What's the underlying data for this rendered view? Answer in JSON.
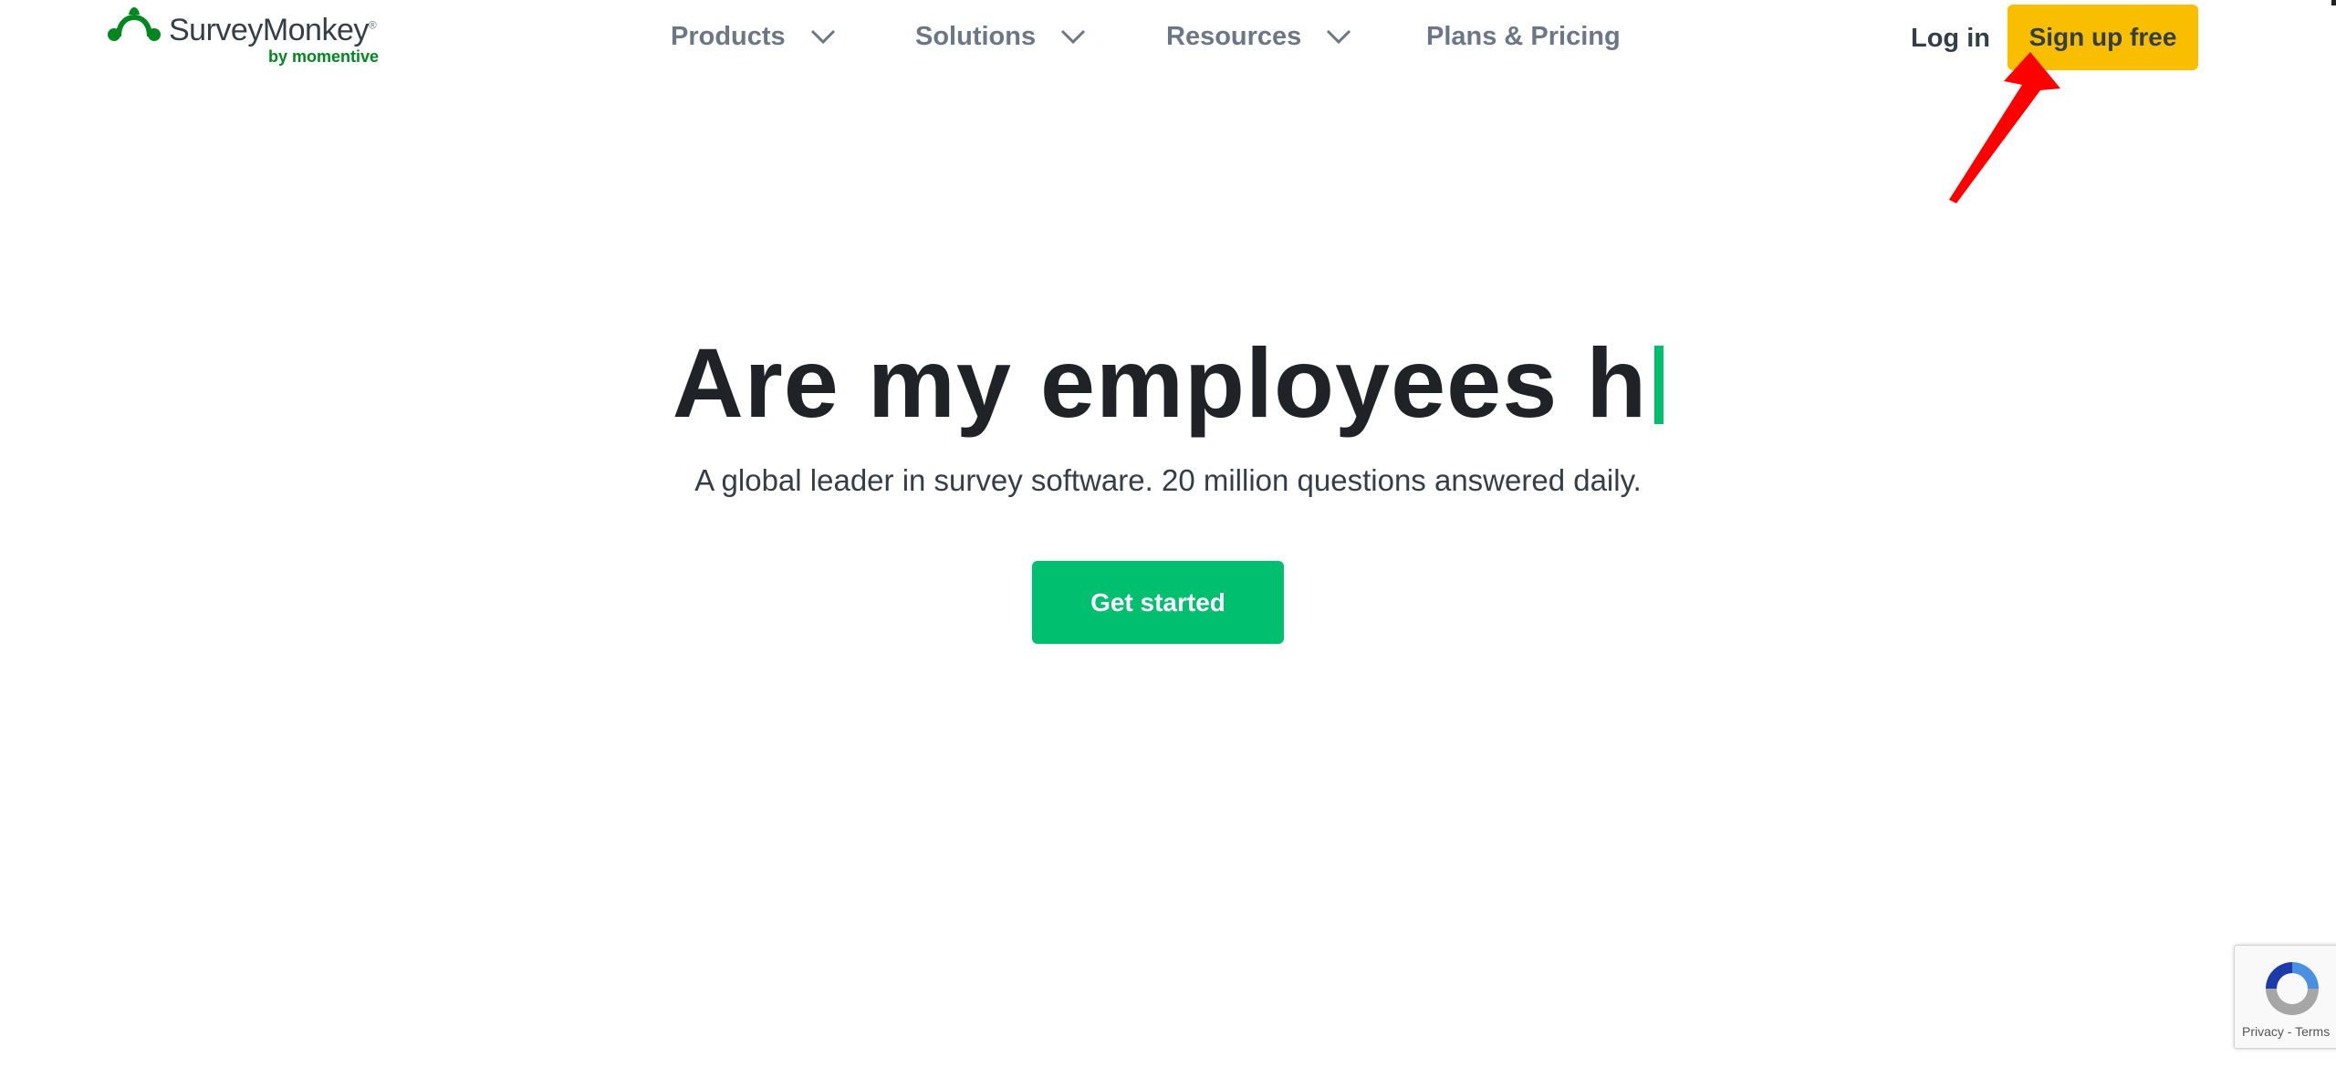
{
  "header": {
    "logo": {
      "wordmark": "SurveyMonkey",
      "registered": "®",
      "byline": "by momentive",
      "brand_green": "#00871f"
    },
    "nav": [
      {
        "label": "Products",
        "has_dropdown": true
      },
      {
        "label": "Solutions",
        "has_dropdown": true
      },
      {
        "label": "Resources",
        "has_dropdown": true
      },
      {
        "label": "Plans & Pricing",
        "has_dropdown": false
      }
    ],
    "login_label": "Log in",
    "signup_label": "Sign up free",
    "signup_color": "#f9be00"
  },
  "annotation": {
    "icon": "red-arrow",
    "color": "#ff0000"
  },
  "hero": {
    "title": "Are my employees h",
    "caret_color": "#00bf6f",
    "subtitle": "A global leader in survey software. 20 million questions answered daily.",
    "cta_label": "Get started",
    "cta_color": "#00bf6f"
  },
  "recaptcha": {
    "icon": "recaptcha-logo",
    "links": "Privacy - Terms"
  }
}
